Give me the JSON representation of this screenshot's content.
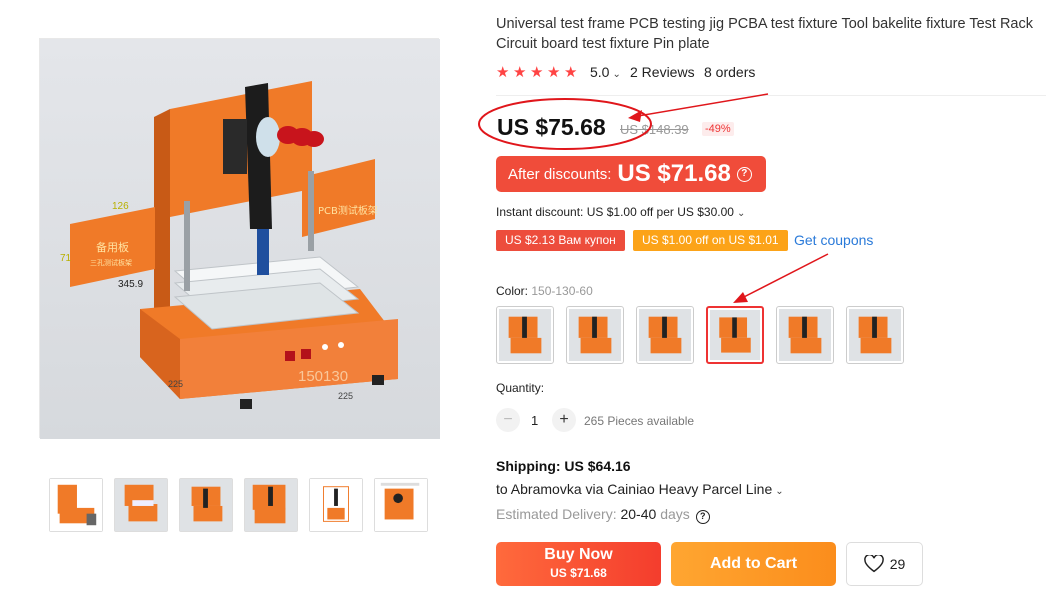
{
  "product": {
    "title": "Universal test frame PCB testing jig PCBA test fixture Tool bakelite fixture Test Rack Circuit board test fixture Pin plate",
    "rating": "5.0",
    "reviews": "2 Reviews",
    "orders": "8 orders",
    "price": "US $75.68",
    "original_price": "US $148.39",
    "discount": "-49%",
    "after_discounts_label": "After discounts:",
    "after_discounts_value": "US $71.68",
    "instant_discount": "Instant discount: US $1.00 off per US $30.00",
    "coupons": [
      "US $2.13 Вам купон",
      "US $1.00 off on US $1.01"
    ],
    "get_coupons": "Get coupons",
    "color_label": "Color:",
    "color_value": "150-130-60",
    "selected_swatch": 3,
    "quantity_label": "Quantity:",
    "quantity": "1",
    "minus": "−",
    "plus": "+",
    "available": "265 Pieces available",
    "shipping": "Shipping: US $64.16",
    "ship_to": "to Abramovka via Cainiao Heavy Parcel Line",
    "est_label": "Estimated Delivery:",
    "est_days": "20-40",
    "est_unit": "days",
    "buy_now": "Buy Now",
    "buy_now_price": "US $71.68",
    "add_to_cart": "Add to Cart",
    "wishlist_count": "29"
  },
  "image_labels": {
    "dim_top": "126",
    "dim_left": "71",
    "dim_depth": "345.9",
    "dim_w1": "225",
    "dim_w2": "225",
    "model": "150130",
    "panel_cn": "备用板",
    "panel_cn_sub": "三孔测试板架",
    "panel_right": "PCB测试板架"
  },
  "colors": {
    "accent_red": "#f04c3a",
    "orange": "#fca318",
    "link_blue": "#2a7ad9",
    "star_red": "#ff4747",
    "fixture_orange": "#f07a28",
    "annotation_red": "#e0161b"
  }
}
